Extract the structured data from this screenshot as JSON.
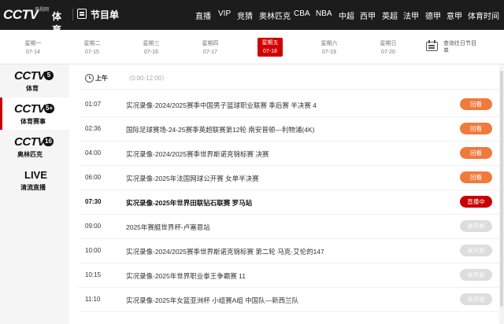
{
  "header": {
    "logo_text": "CCTV",
    "logo_cn": "央视网",
    "logo_sub": "体育",
    "page_title": "节目单",
    "nav": [
      "直播",
      "VIP",
      "竞猜",
      "奥林匹克",
      "CBA",
      "NBA",
      "中超",
      "西甲",
      "英超",
      "法甲",
      "德甲",
      "意甲",
      "体育时间"
    ]
  },
  "dates": [
    {
      "weekday": "星期一",
      "date": "07-14"
    },
    {
      "weekday": "星期二",
      "date": "07-15"
    },
    {
      "weekday": "星期三",
      "date": "07-16"
    },
    {
      "weekday": "星期四",
      "date": "07-17"
    },
    {
      "weekday": "星期五",
      "date": "07-18",
      "active": true
    },
    {
      "weekday": "星期六",
      "date": "07-19"
    },
    {
      "weekday": "星期日",
      "date": "07-20"
    }
  ],
  "calendar": {
    "label": "查询往日节目单",
    "icon": "calendar-icon"
  },
  "channels": [
    {
      "logo": "CCTV",
      "number": "5",
      "name": "体育",
      "active": false
    },
    {
      "logo": "CCTV",
      "number": "5+",
      "name": "体育赛事",
      "active": true
    },
    {
      "logo": "CCTV",
      "number": "16",
      "name": "奥林匹克",
      "active": false
    },
    {
      "logo": "LIVE",
      "number": "",
      "name": "清流直播",
      "active": false
    }
  ],
  "period": {
    "name": "上午",
    "range": "（0:00-12:00）",
    "icon": "clock-icon"
  },
  "programs": [
    {
      "time": "01:07",
      "title": "实况录像-2024/2025赛季中国男子篮球职业联赛 季后赛 半决赛 4",
      "status": "回看",
      "type": "replay"
    },
    {
      "time": "02:36",
      "title": "国际足球赛场-24-25赛季英超联赛第12轮 南安普顿—利物浦(4K)",
      "status": "回看",
      "type": "replay"
    },
    {
      "time": "04:00",
      "title": "实况录像-2024/2025赛季世界斯诺克锦标赛 决赛",
      "status": "回看",
      "type": "replay"
    },
    {
      "time": "06:00",
      "title": "实况录像-2025年法国网球公开赛 女单半决赛",
      "status": "回看",
      "type": "replay"
    },
    {
      "time": "07:30",
      "title": "实况录像-2025年世界田联钻石联赛 罗马站",
      "status": "直播中",
      "type": "live"
    },
    {
      "time": "09:00",
      "title": "2025年赛艇世界杯-卢塞恩站",
      "status": "未开始",
      "type": "upcoming"
    },
    {
      "time": "10:00",
      "title": "实况录像-2024/2025赛季世界斯诺克锦标赛 第二轮 马克·艾伦的147",
      "status": "未开始",
      "type": "upcoming"
    },
    {
      "time": "10:15",
      "title": "实况录像-2025年世界职业拳王争霸赛 11",
      "status": "未开始",
      "type": "upcoming"
    },
    {
      "time": "11:10",
      "title": "实况录像-2025年女篮亚洲杯 小组赛A组 中国队—新西兰队",
      "status": "未开始",
      "type": "upcoming"
    }
  ],
  "colors": {
    "accent": "#d10000",
    "replay": "#f07a3c",
    "live": "#c80000",
    "upcoming": "#dddddd",
    "topbar": "#1c1c1c"
  }
}
